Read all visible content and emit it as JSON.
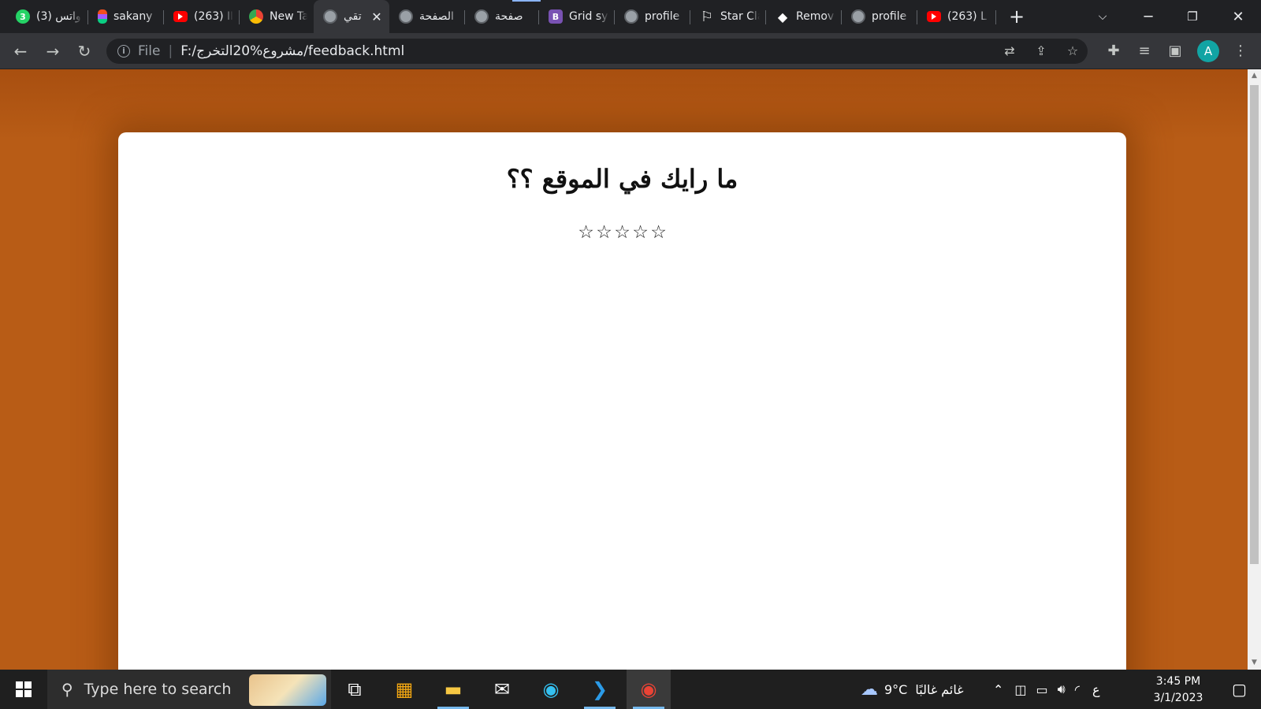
{
  "browser": {
    "tabs": [
      {
        "title": "(3) واتس",
        "icon": "whatsapp-icon"
      },
      {
        "title": "sakany",
        "icon": "figma-icon"
      },
      {
        "title": "(263) اا",
        "icon": "youtube-icon"
      },
      {
        "title": "New Ta",
        "icon": "chrome-icon"
      },
      {
        "title": "تقي",
        "icon": "globe-icon",
        "active": true
      },
      {
        "title": "الصفحة",
        "icon": "globe-icon"
      },
      {
        "title": "صفحة",
        "icon": "globe-icon"
      },
      {
        "title": "Grid sy",
        "icon": "bootstrap-icon"
      },
      {
        "title": "profile",
        "icon": "globe-icon"
      },
      {
        "title": "Star Cla",
        "icon": "flag-icon"
      },
      {
        "title": "Remov",
        "icon": "layers-icon"
      },
      {
        "title": "profile",
        "icon": "globe-icon"
      },
      {
        "title": "(263) L",
        "icon": "youtube-icon"
      }
    ],
    "address": {
      "scheme": "File",
      "url": "F:/مشروع%20التخرج/feedback.html"
    },
    "profile_initial": "A"
  },
  "page": {
    "heading": "ما رايك في الموقع ؟؟",
    "rating": {
      "value": 0,
      "max": 5,
      "star_glyph": "☆"
    }
  },
  "taskbar": {
    "search_placeholder": "Type here to search",
    "weather": {
      "temp": "9°C",
      "condition": "غائم غالبًا"
    },
    "input_language": "ع",
    "time": "3:45 PM",
    "date": "3/1/2023"
  },
  "colors": {
    "page_background": "#b85c16",
    "card_background": "#ffffff",
    "browser_dark": "#202124"
  }
}
